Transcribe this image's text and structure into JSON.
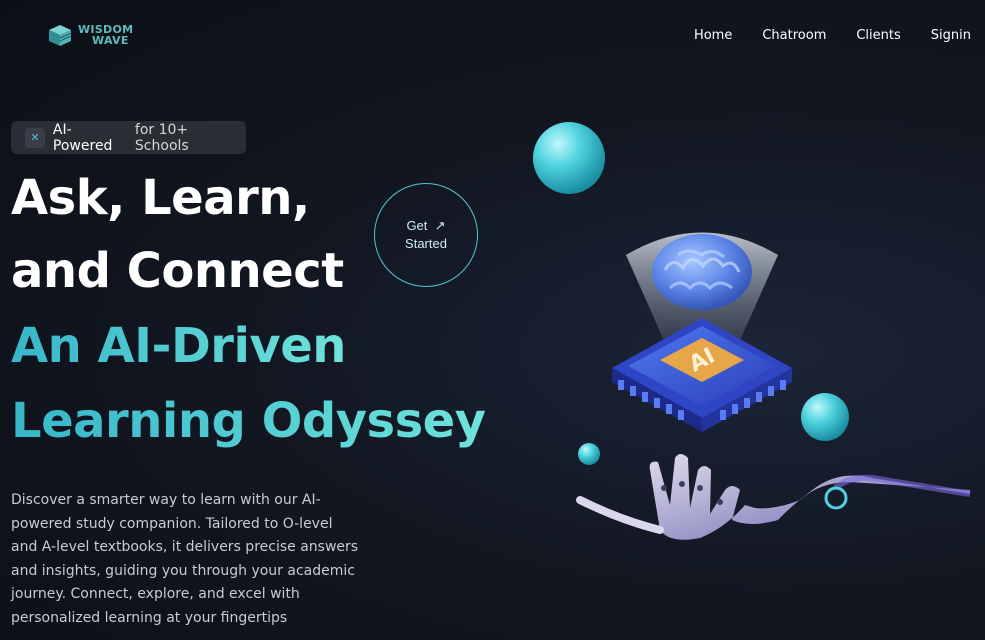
{
  "brand": {
    "line1": "WISDOM",
    "line2": "WAVE"
  },
  "nav": {
    "items": [
      "Home",
      "Chatroom",
      "Clients",
      "Signin"
    ]
  },
  "badge": {
    "icon": "sparkle-icon",
    "strong": "AI-Powered",
    "rest": "for 10+ Schools"
  },
  "hero": {
    "line1": "Ask, Learn,",
    "line2": "and Connect",
    "line3": "An AI-Driven",
    "line4": "Learning Odyssey",
    "cta_line1": "Get",
    "cta_line2": "Started",
    "cta_icon": "arrow-up-right-icon",
    "description": "Discover a smarter way to learn with our AI-powered study companion. Tailored to O-level and A-level textbooks, it delivers precise answers and insights, guiding you through your academic journey. Connect, explore, and excel with personalized learning at your fingertips"
  },
  "colors": {
    "accent": "#4ecbd3",
    "background": "#0d0f16"
  }
}
